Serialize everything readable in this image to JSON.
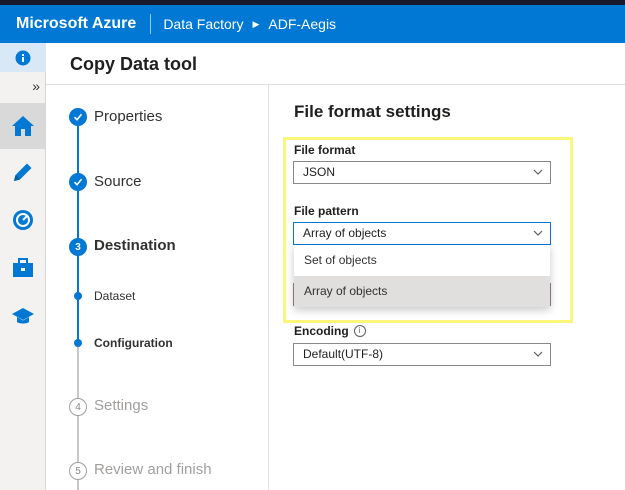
{
  "topbar": {
    "brand": "Microsoft Azure",
    "breadcrumb": [
      "Data Factory",
      "ADF-Aegis"
    ],
    "color": "#0078d4"
  },
  "leftnav": {
    "expand_glyph": "»",
    "items": [
      {
        "icon": "info-icon"
      },
      {
        "icon": "home-icon",
        "active": true
      },
      {
        "icon": "pencil-icon"
      },
      {
        "icon": "monitor-icon"
      },
      {
        "icon": "toolbox-icon"
      },
      {
        "icon": "graduation-cap-icon"
      }
    ]
  },
  "page": {
    "title": "Copy Data tool"
  },
  "steps": [
    {
      "label": "Properties",
      "state": "done"
    },
    {
      "label": "Source",
      "state": "done"
    },
    {
      "label": "Destination",
      "number": "3",
      "state": "current"
    },
    {
      "label": "Dataset",
      "state": "substep"
    },
    {
      "label": "Configuration",
      "state": "substep-current"
    },
    {
      "label": "Settings",
      "number": "4",
      "state": "future"
    },
    {
      "label": "Review and finish",
      "number": "5",
      "state": "future"
    }
  ],
  "settings": {
    "title": "File format settings",
    "file_format_label": "File format",
    "file_format_value": "JSON",
    "file_pattern_label": "File pattern",
    "file_pattern_value": "Array of objects",
    "file_pattern_options": [
      "Set of objects",
      "Array of objects"
    ],
    "encoding_label": "Encoding",
    "encoding_value": "Default(UTF-8)",
    "highlight_color": "#fcf77a"
  }
}
